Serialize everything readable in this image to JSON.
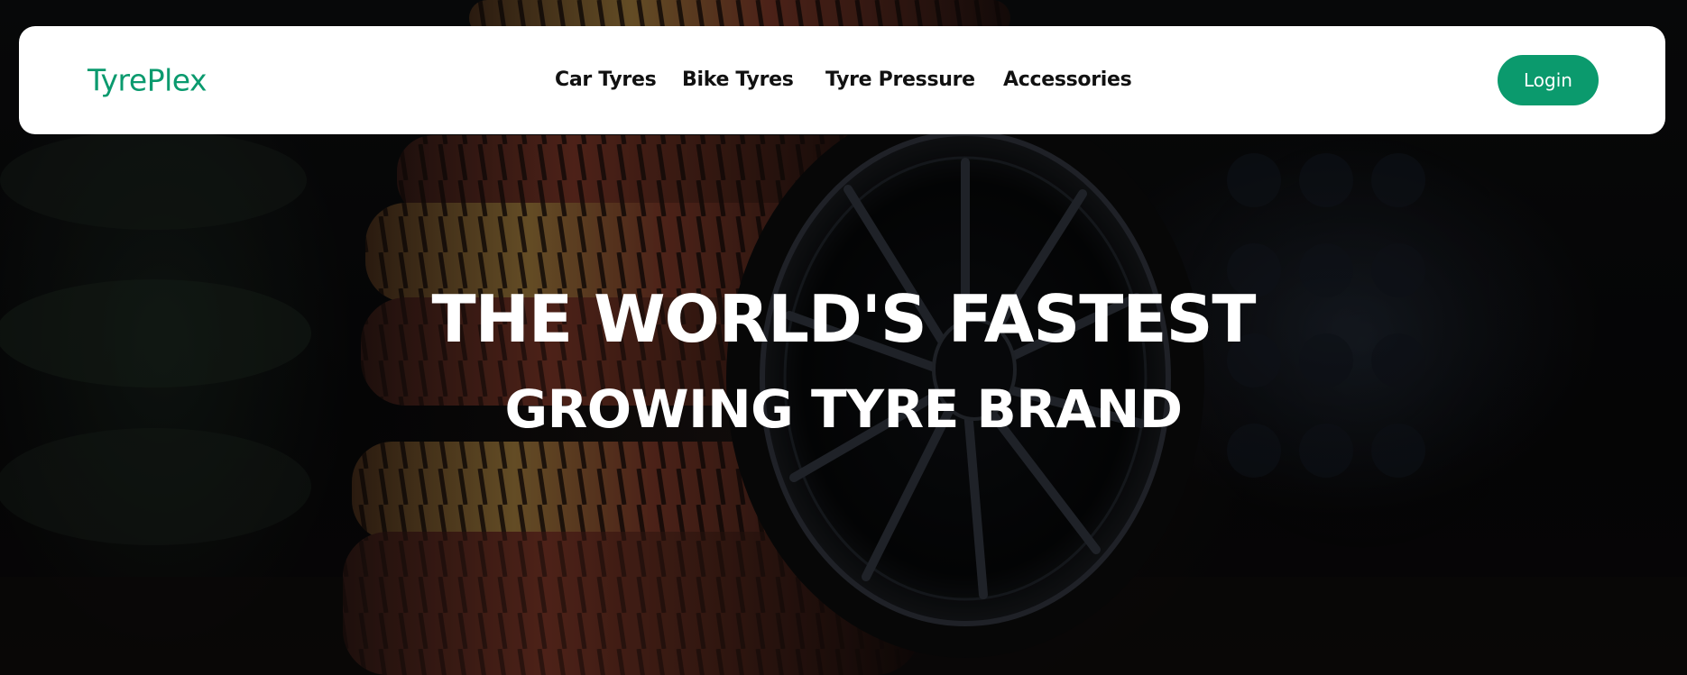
{
  "brand": {
    "name": "TyrePlex",
    "color": "#0a9a6e"
  },
  "nav": {
    "items": [
      {
        "label": "Car Tyres"
      },
      {
        "label": "Bike Tyres"
      },
      {
        "label": "Tyre Pressure"
      },
      {
        "label": "Accessories"
      }
    ],
    "login_label": "Login",
    "login_color": "#0b9a6d"
  },
  "hero": {
    "headline_line1": "THE WORLD'S FASTEST",
    "headline_line2": "GROWING TYRE BRAND",
    "background_image": "tyre-stack-with-alloy-wheel"
  }
}
